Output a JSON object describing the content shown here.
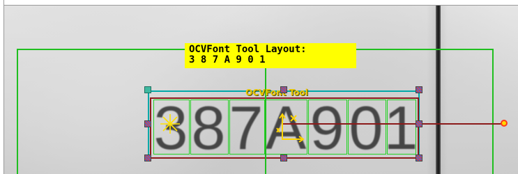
{
  "layout_label": {
    "line1": "OCVFont Tool Layout:",
    "line2": "3 8 7 A 9 0 1"
  },
  "tool_label": "OCVFont Tool",
  "characters": [
    "3",
    "8",
    "7",
    "A",
    "9",
    "0",
    "1"
  ],
  "colors": {
    "region": "#1fbf1f",
    "tool_box": "#00a8a8",
    "inner_box": "#8b1a1a",
    "char_box": "#23d323",
    "label_bg": "#ffff00",
    "tool_label": "#e8c800",
    "axis": "#8b1a1a",
    "axis_end": "#ff3a1a"
  },
  "icons": {
    "origin": "star-marker-icon",
    "axes": "coordinate-axes-icon",
    "endpoint": "axis-endpoint-icon"
  }
}
